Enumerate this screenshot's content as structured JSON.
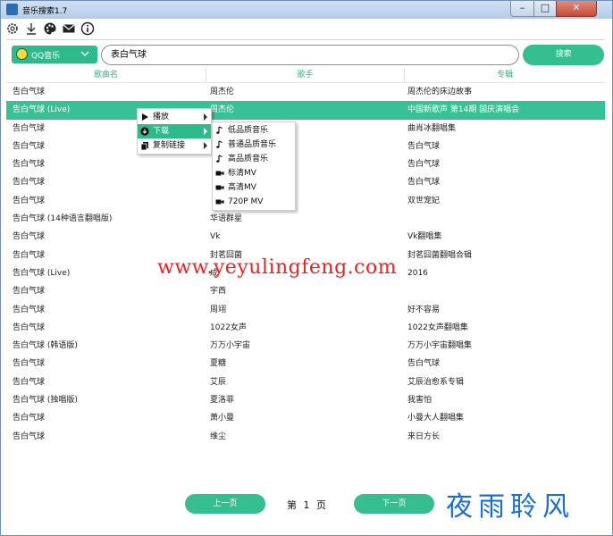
{
  "window": {
    "title": "音乐搜索1.7",
    "min": "–",
    "max": "□",
    "close": "✕"
  },
  "toolbar": {
    "icons": [
      "settings-icon",
      "download-icon",
      "palette-icon",
      "mail-icon",
      "info-icon"
    ]
  },
  "search": {
    "source": "QQ音乐",
    "query": "表白气球",
    "button": "搜索"
  },
  "table": {
    "headers": [
      "歌曲名",
      "歌手",
      "专辑"
    ],
    "rows": [
      [
        "告白气球",
        "周杰伦",
        "周杰伦的床边故事"
      ],
      [
        "告白气球 (Live)",
        "周杰伦",
        "中国新歌声 第14期 国庆演唱会"
      ],
      [
        "告白气球",
        "",
        "曲肖冰翻唱集"
      ],
      [
        "告白气球",
        "",
        "告白气球"
      ],
      [
        "告白气球",
        "",
        "告白气球"
      ],
      [
        "告白气球",
        "",
        "告白气球"
      ],
      [
        "告白气球",
        "",
        "双世宠妃"
      ],
      [
        "告白气球 (14种语言翻唱版)",
        "华语群星",
        ""
      ],
      [
        "告白气球",
        "Vk",
        "Vk翻唱集"
      ],
      [
        "告白气球",
        "封茗囧菌",
        "封茗囧菌翻唱合辑"
      ],
      [
        "告白气球 (Live)",
        "成",
        "2016"
      ],
      [
        "告白气球",
        "宇西",
        ""
      ],
      [
        "告白气球",
        "周翊",
        "好不容易"
      ],
      [
        "告白气球",
        "1022女声",
        "1022女声翻唱集"
      ],
      [
        "告白气球 (韩语版)",
        "万万小宇宙",
        "万万小宇宙翻唱集"
      ],
      [
        "告白气球",
        "夏糖",
        "告白气球"
      ],
      [
        "告白气球",
        "艾辰",
        "艾辰治愈系专辑"
      ],
      [
        "告白气球 (独唱版)",
        "夏洛菲",
        "我害怕"
      ],
      [
        "告白气球",
        "萧小曼",
        "小曼大人翻唱集"
      ],
      [
        "告白气球",
        "维尘",
        "来日方长"
      ]
    ],
    "selected_row": 1
  },
  "context_menu": {
    "items": [
      {
        "label": "播放",
        "icon": "play-icon"
      },
      {
        "label": "下载",
        "icon": "download-circle-icon"
      },
      {
        "label": "复制链接",
        "icon": "copy-icon"
      }
    ],
    "submenu": [
      {
        "label": "低品质音乐",
        "icon": "music-note-icon"
      },
      {
        "label": "普通品质音乐",
        "icon": "music-note-icon"
      },
      {
        "label": "高品质音乐",
        "icon": "music-note-icon"
      },
      {
        "label": "标清MV",
        "icon": "video-camera-icon"
      },
      {
        "label": "高清MV",
        "icon": "video-camera-icon"
      },
      {
        "label": "720P MV",
        "icon": "video-camera-icon"
      }
    ]
  },
  "watermark": "www.yeyulingfeng.com",
  "pager": {
    "prev": "上一页",
    "next": "下一页",
    "page_prefix": "第",
    "page": "1",
    "page_suffix": "页"
  },
  "brand": "夜雨聆风",
  "colors": {
    "accent": "#35be8f",
    "watermark": "#ee2222",
    "brand": "#1b6ed6"
  }
}
